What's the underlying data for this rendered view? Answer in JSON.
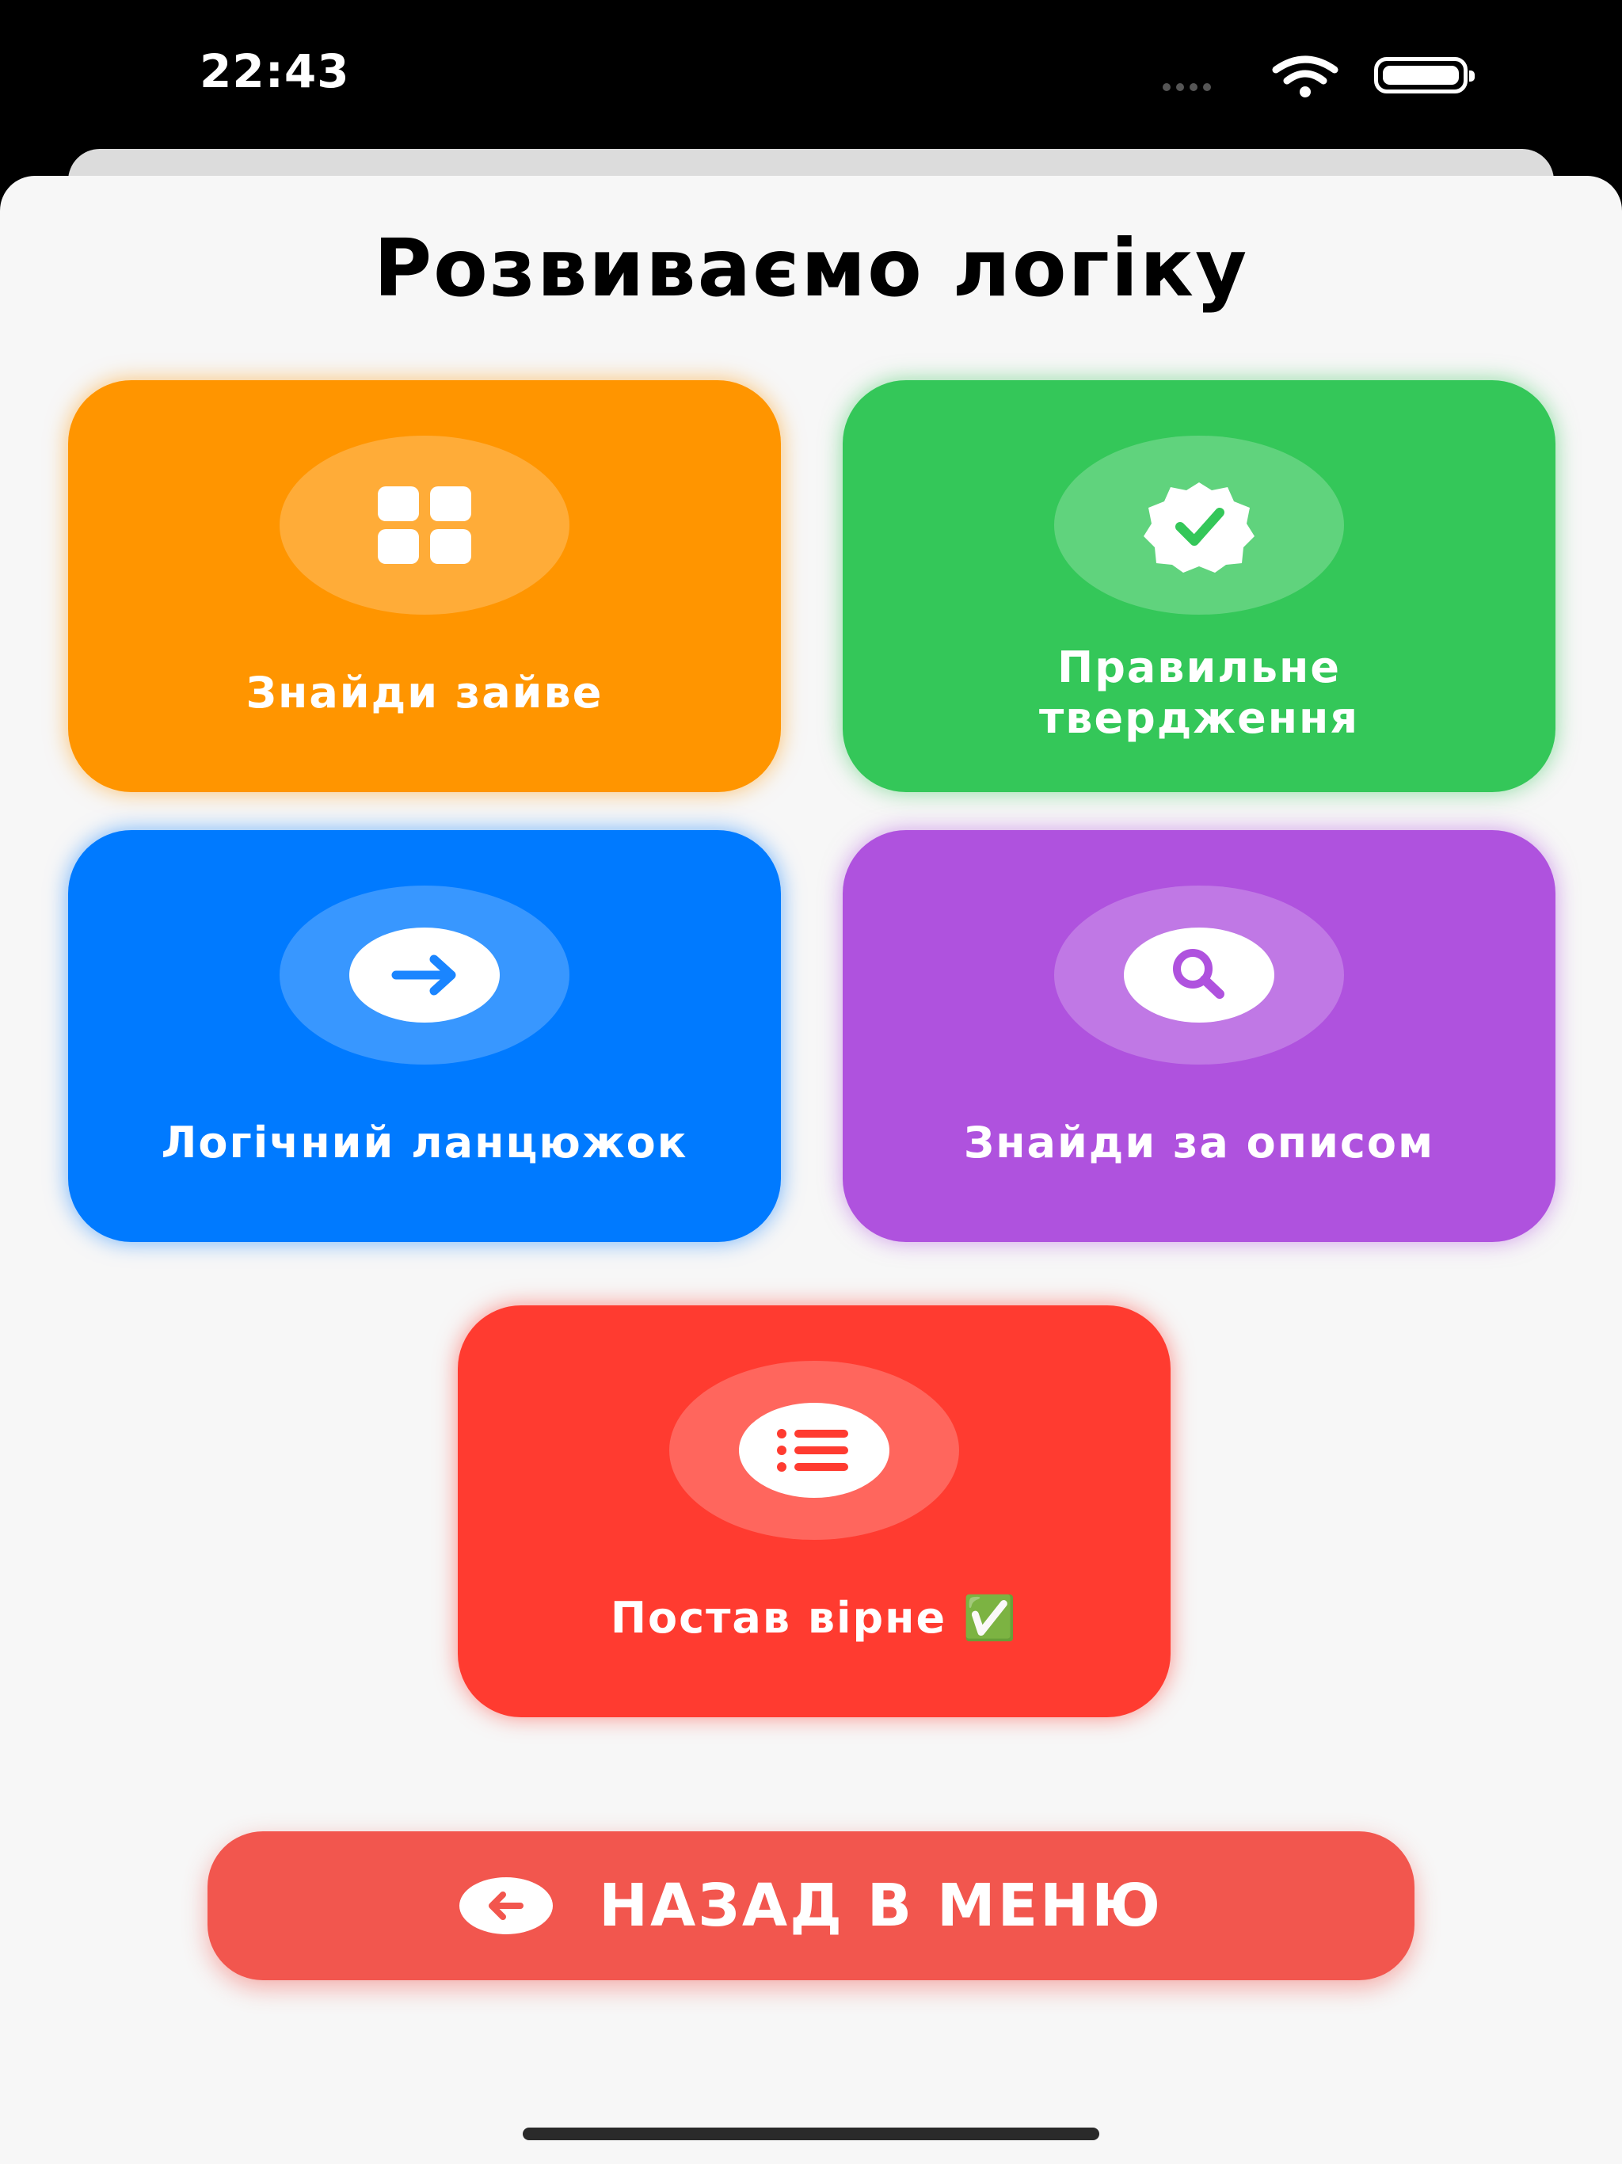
{
  "status_bar": {
    "time": "22:43",
    "icons": [
      "signal-dots-icon",
      "wifi-icon",
      "battery-icon"
    ]
  },
  "screen": {
    "title": "Розвиваємо логіку"
  },
  "tiles": [
    {
      "label": "Знайди зайве",
      "icon": "grid-icon",
      "color": "#ff9500"
    },
    {
      "label": "Правильне\nтвердження",
      "icon": "verified-badge-icon",
      "color": "#34c759"
    },
    {
      "label": "Логічний ланцюжок",
      "icon": "arrow-right-icon",
      "color": "#007aff"
    },
    {
      "label": "Знайди за описом",
      "icon": "magnifier-icon",
      "color": "#af52de"
    },
    {
      "label": "Постав вірне ✅",
      "icon": "list-icon",
      "color": "#ff3b30"
    }
  ],
  "back_button": {
    "label": "НАЗАД В МЕНЮ",
    "icon": "arrow-left-circle-icon",
    "color": "#f2564e"
  }
}
